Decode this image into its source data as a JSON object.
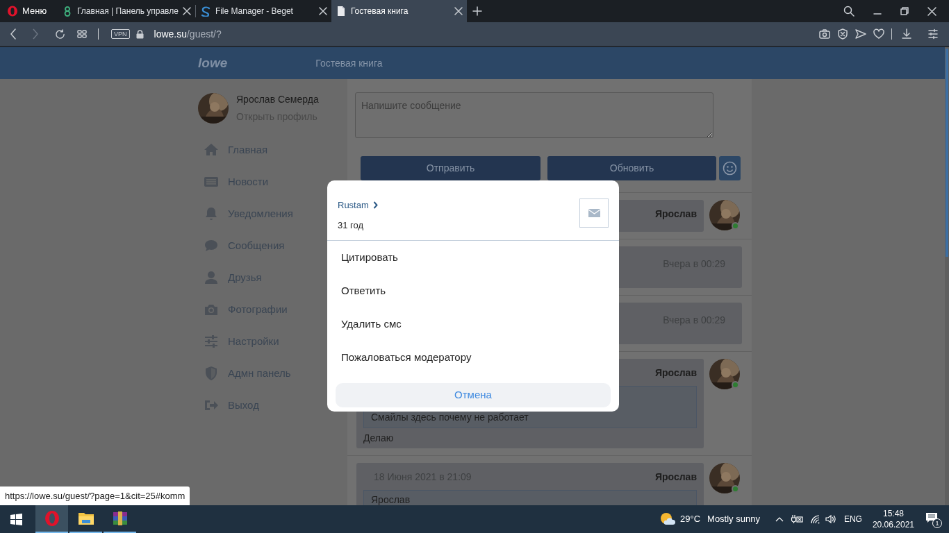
{
  "browser": {
    "menu_label": "Меню",
    "tabs": [
      {
        "label": "Главная | Панель управле",
        "selected": false
      },
      {
        "label": "File Manager - Beget",
        "selected": false
      },
      {
        "label": "Гостевая книга",
        "selected": true
      }
    ],
    "vpn_badge": "VPN",
    "address": {
      "host": "lowe.su",
      "path": "/guest/?"
    }
  },
  "site": {
    "logo": "lowe",
    "nav": "Гостевая книга"
  },
  "profile": {
    "name": "Ярослав Семерда",
    "link": "Открыть профиль"
  },
  "sidebar": {
    "items": [
      {
        "label": "Главная"
      },
      {
        "label": "Новости"
      },
      {
        "label": "Уведомления"
      },
      {
        "label": "Сообщения"
      },
      {
        "label": "Друзья"
      },
      {
        "label": "Фотографии"
      },
      {
        "label": "Настройки"
      },
      {
        "label": "Адмн панель"
      },
      {
        "label": "Выход"
      }
    ]
  },
  "composer": {
    "placeholder": "Напишите сообщение",
    "buttons": [
      "Отправить",
      "Обновить"
    ]
  },
  "messages": [
    {
      "kind": "own",
      "author": "Ярослав"
    },
    {
      "kind": "other",
      "time": "Вчера в 00:29"
    },
    {
      "kind": "other",
      "time": "Вчера в 00:29"
    },
    {
      "kind": "own",
      "author": "Ярослав",
      "quote": {
        "text": "Смайлы здесь почему не работает"
      },
      "text": "Делаю"
    },
    {
      "kind": "own",
      "time": "18 Июня 2021 в 21:09",
      "author": "Ярослав",
      "quote": {
        "author": "Ярослав"
      }
    }
  ],
  "modal": {
    "user": "Rustam",
    "age": "31 год",
    "actions": [
      "Цитировать",
      "Ответить",
      "Удалить смс",
      "Пожаловаться модератору"
    ],
    "cancel": "Отмена"
  },
  "status_url": "https://lowe.su/guest/?page=1&cit=25#komm",
  "taskbar": {
    "temperature": "29°C",
    "weather": "Mostly sunny",
    "language": "ENG",
    "time": "15:48",
    "date": "20.06.2021",
    "notifications": "1"
  }
}
